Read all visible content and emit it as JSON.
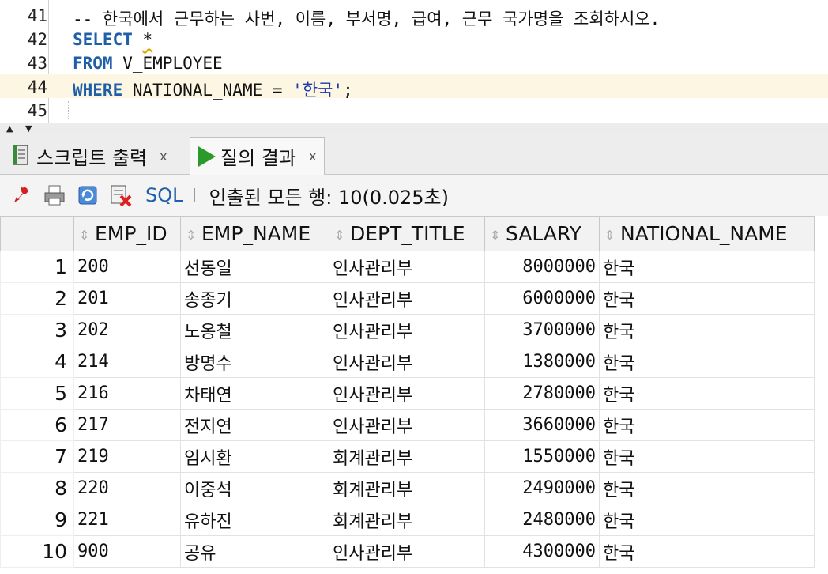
{
  "editor": {
    "lines": [
      {
        "num": "41",
        "comment": "-- 한국에서 근무하는 사번, 이름, 부서명, 급여, 근무 국가명을 조회하시오."
      },
      {
        "num": "42",
        "kw": "SELECT",
        "rest": "*"
      },
      {
        "num": "43",
        "kw": "FROM",
        "rest": "V_EMPLOYEE"
      },
      {
        "num": "44",
        "kw": "WHERE",
        "rest": "NATIONAL_NAME = ",
        "str": "'한국'",
        "tail": ";"
      },
      {
        "num": "45"
      }
    ]
  },
  "tabs": [
    {
      "label": "스크립트 출력",
      "close": "x",
      "icon": "script-icon",
      "active": false
    },
    {
      "label": "질의 결과",
      "close": "x",
      "icon": "play-icon",
      "active": true
    }
  ],
  "toolbar": {
    "sql_label": "SQL",
    "separator": "|",
    "status": "인출된 모든 행: 10(0.025초)"
  },
  "grid": {
    "columns": [
      "EMP_ID",
      "EMP_NAME",
      "DEPT_TITLE",
      "SALARY",
      "NATIONAL_NAME"
    ],
    "rows": [
      [
        "1",
        "200",
        "선동일",
        "인사관리부",
        "8000000",
        "한국"
      ],
      [
        "2",
        "201",
        "송종기",
        "인사관리부",
        "6000000",
        "한국"
      ],
      [
        "3",
        "202",
        "노옹철",
        "인사관리부",
        "3700000",
        "한국"
      ],
      [
        "4",
        "214",
        "방명수",
        "인사관리부",
        "1380000",
        "한국"
      ],
      [
        "5",
        "216",
        "차태연",
        "인사관리부",
        "2780000",
        "한국"
      ],
      [
        "6",
        "217",
        "전지연",
        "인사관리부",
        "3660000",
        "한국"
      ],
      [
        "7",
        "219",
        "임시환",
        "회계관리부",
        "1550000",
        "한국"
      ],
      [
        "8",
        "220",
        "이중석",
        "회계관리부",
        "2490000",
        "한국"
      ],
      [
        "9",
        "221",
        "유하진",
        "회계관리부",
        "2480000",
        "한국"
      ],
      [
        "10",
        "900",
        "공유",
        "인사관리부",
        "4300000",
        "한국"
      ]
    ]
  },
  "colors": {
    "keyword": "#1f5fa8",
    "comment": "#8a8a8a",
    "current_line": "#fdf6e3",
    "run_green": "#2a9a2a"
  }
}
